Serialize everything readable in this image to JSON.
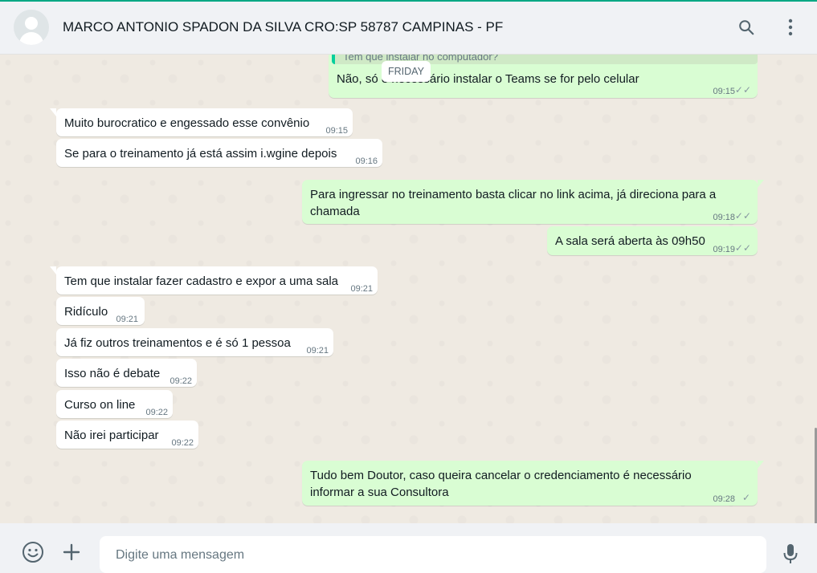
{
  "header": {
    "contact_name": "MARCO ANTONIO SPADON DA SILVA CRO:SP 58787 CAMPINAS - PF",
    "avatar_icon": "default-avatar-icon",
    "search_icon": "search-icon",
    "menu_icon": "more-vertical-icon"
  },
  "chat": {
    "day_divider": "FRIDAY",
    "quoted_text": "Tem que instalar no computador?",
    "messages": [
      {
        "dir": "out",
        "text": "Não, só é necessário instalar o Teams se for pelo celular",
        "time": "09:15",
        "status": "read"
      },
      {
        "dir": "in",
        "text": "Muito burocratico e engessado esse convênio",
        "time": "09:15"
      },
      {
        "dir": "in",
        "text": "Se para o treinamento  já está assim i.wgine depois",
        "time": "09:16"
      },
      {
        "dir": "out",
        "text_line1": "Para ingressar no treinamento basta clicar no link acima, já direciona para a",
        "text_line2": "chamada",
        "time": "09:18",
        "status": "read"
      },
      {
        "dir": "out",
        "text": "A sala será aberta às 09h50",
        "time": "09:19",
        "status": "read"
      },
      {
        "dir": "in",
        "text": "Tem que instalar fazer cadastro e expor a uma sala",
        "time": "09:21"
      },
      {
        "dir": "in",
        "text": "Ridículo",
        "time": "09:21"
      },
      {
        "dir": "in",
        "text": "Já fiz outros treinamentos  e é só 1 pessoa",
        "time": "09:21"
      },
      {
        "dir": "in",
        "text": "Isso não é debate",
        "time": "09:22"
      },
      {
        "dir": "in",
        "text": "Curso on line",
        "time": "09:22"
      },
      {
        "dir": "in",
        "text": "Não irei participar",
        "time": "09:22"
      },
      {
        "dir": "out",
        "text_line1": "Tudo bem Doutor, caso queira cancelar o credenciamento é necessário",
        "text_line2": "informar a sua Consultora",
        "time": "09:28",
        "status": "sent"
      }
    ]
  },
  "footer": {
    "emoji_icon": "emoji-icon",
    "attach_icon": "plus-icon",
    "input_placeholder": "Digite uma mensagem",
    "mic_icon": "microphone-icon"
  },
  "colors": {
    "accent": "#00a884",
    "outgoing_bubble": "#d9fdd3",
    "incoming_bubble": "#ffffff",
    "background": "#efeae2",
    "read_ticks": "#8696a0"
  }
}
